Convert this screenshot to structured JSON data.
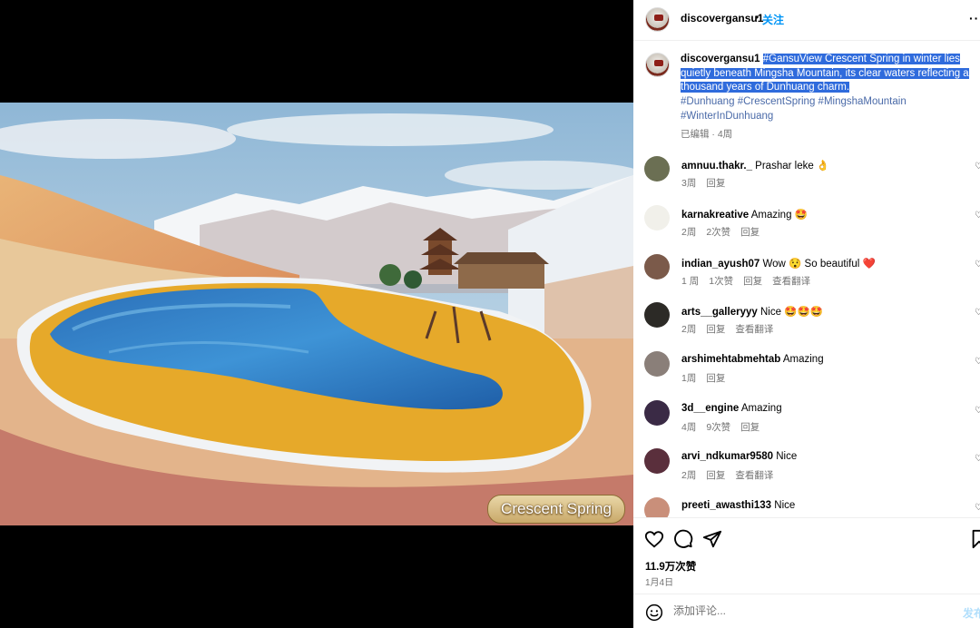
{
  "post": {
    "username": "discovergansu1",
    "dot": "•",
    "follow_label": "关注",
    "more_icon": "more-horizontal-icon",
    "caption_hashtag_lead": "#GansuView",
    "caption_text": " Crescent Spring in winter lies quietly beneath Mingsha Mountain, its clear waters reflecting a thousand years of Dunhuang charm.",
    "hashtags": [
      "#Dunhuang",
      "#CrescentSpring",
      "#MingshaMountain",
      "#WinterInDunhuang"
    ],
    "caption_meta": "已编辑 · 4周",
    "image_caption": "Crescent Spring"
  },
  "comments": [
    {
      "user": "amnuu.thakr._",
      "text": "Prashar leke 👌",
      "time": "3周",
      "likes": "",
      "reply": "回复",
      "translate": "",
      "avatar_color": "#6b6f53"
    },
    {
      "user": "karnakreative",
      "text": "Amazing 🤩",
      "time": "2周",
      "likes": "2次赞",
      "reply": "回复",
      "translate": "",
      "avatar_color": "#f1f0ea"
    },
    {
      "user": "indian_ayush07",
      "text": "Wow 😯 So beautiful ❤️",
      "time": "1 周",
      "likes": "1次赞",
      "reply": "回复",
      "translate": "查看翻译",
      "avatar_color": "#7b5a4a"
    },
    {
      "user": "arts__galleryyy",
      "text": "Nice 🤩🤩🤩",
      "time": "2周",
      "likes": "",
      "reply": "回复",
      "translate": "查看翻译",
      "avatar_color": "#2c2a26"
    },
    {
      "user": "arshimehtabmehtab",
      "text": "Amazing",
      "time": "1周",
      "likes": "",
      "reply": "回复",
      "translate": "",
      "avatar_color": "#8a7f79"
    },
    {
      "user": "3d__engine",
      "text": "Amazing",
      "time": "4周",
      "likes": "9次赞",
      "reply": "回复",
      "translate": "",
      "avatar_color": "#3a2a45"
    },
    {
      "user": "arvi_ndkumar9580",
      "text": "Nice",
      "time": "2周",
      "likes": "",
      "reply": "回复",
      "translate": "查看翻译",
      "avatar_color": "#5a2f3c"
    },
    {
      "user": "preeti_awasthi133",
      "text": "Nice",
      "time": "",
      "likes": "",
      "reply": "",
      "translate": "",
      "avatar_color": "#c98f7a"
    }
  ],
  "actions": {
    "like_icon": "heart-icon",
    "comment_icon": "comment-bubble-icon",
    "share_icon": "send-icon",
    "save_icon": "bookmark-icon",
    "likes_count": "11.9万次赞",
    "date": "1月4日"
  },
  "comment_bar": {
    "emoji_icon": "emoji-smile-icon",
    "placeholder": "添加评论...",
    "post_label": "发布"
  },
  "colors": {
    "link_blue": "#0095f6",
    "selection": "#2f6bdc",
    "muted": "#737373"
  }
}
